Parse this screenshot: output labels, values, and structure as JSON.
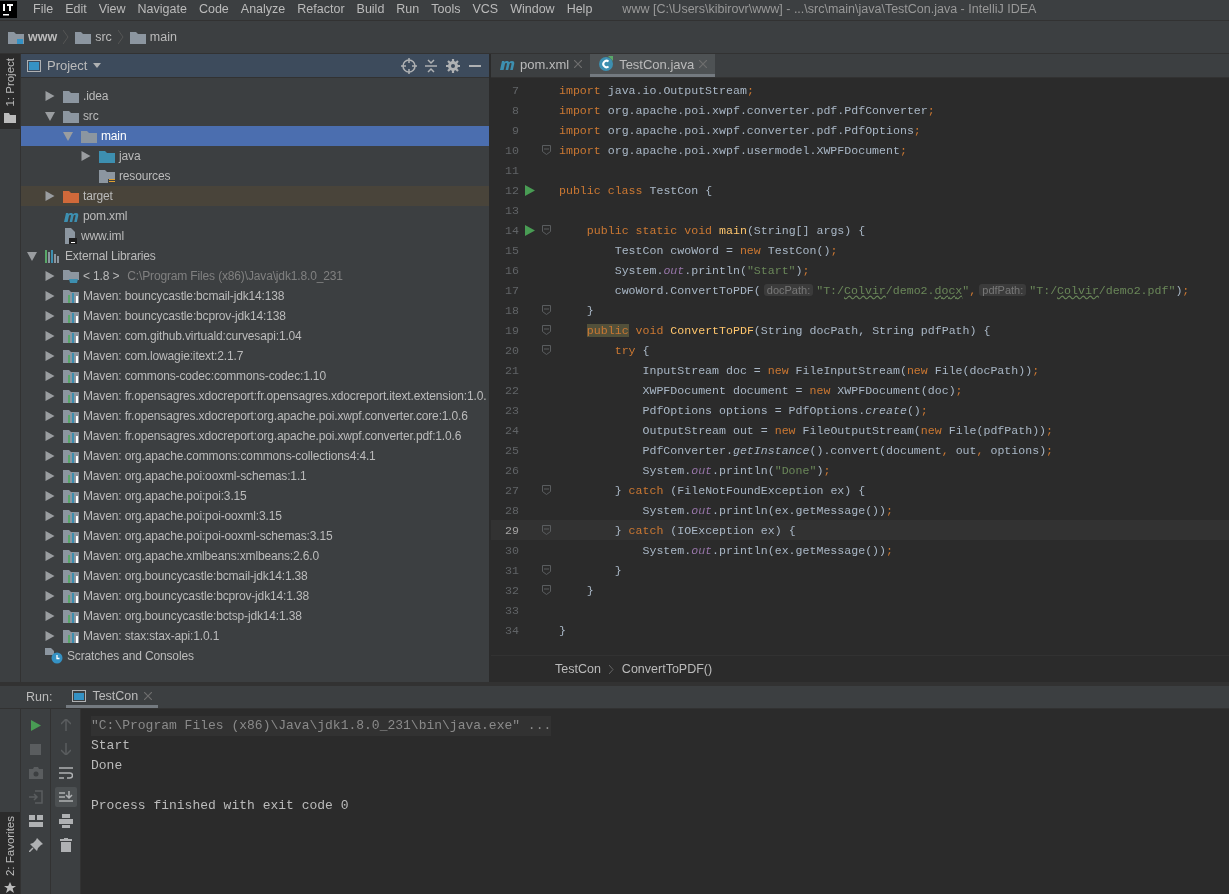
{
  "menu": [
    "File",
    "Edit",
    "View",
    "Navigate",
    "Code",
    "Analyze",
    "Refactor",
    "Build",
    "Run",
    "Tools",
    "VCS",
    "Window",
    "Help"
  ],
  "window_title": "www [C:\\Users\\kibirovr\\www] - ...\\src\\main\\java\\TestCon.java - IntelliJ IDEA",
  "navbar": [
    {
      "label": "www",
      "kind": "module"
    },
    {
      "label": "src",
      "kind": "folder"
    },
    {
      "label": "main",
      "kind": "folder"
    }
  ],
  "side_stripe": {
    "top": "1: Project",
    "bottom": "2: Favorites"
  },
  "project_panel": {
    "title": "Project",
    "tree": [
      {
        "children": [
          {
            "label": ".idea",
            "kind": "folder",
            "expanded": false,
            "selected": false
          },
          {
            "label": "src",
            "kind": "folder",
            "expanded": true,
            "selected": false,
            "children": [
              {
                "label": "main",
                "kind": "folder",
                "expanded": true,
                "selected": true,
                "children": [
                  {
                    "label": "java",
                    "kind": "source-folder",
                    "expanded": false,
                    "selected": false
                  },
                  {
                    "label": "resources",
                    "kind": "resources-folder",
                    "selected": false
                  }
                ]
              }
            ]
          },
          {
            "label": "target",
            "kind": "excluded-folder",
            "expanded": false,
            "selected": false
          },
          {
            "label": "pom.xml",
            "kind": "maven",
            "selected": false
          },
          {
            "label": "www.iml",
            "kind": "iml",
            "selected": false
          }
        ]
      },
      {
        "label": "External Libraries",
        "kind": "libraries",
        "expanded": true,
        "selected": false,
        "children": [
          {
            "label": "< 1.8 >",
            "hint": "C:\\Program Files (x86)\\Java\\jdk1.8.0_231",
            "kind": "jdk",
            "expanded": false,
            "selected": false
          },
          {
            "label": "Maven: bouncycastle:bcmail-jdk14:138",
            "kind": "library",
            "expanded": false,
            "selected": false
          },
          {
            "label": "Maven: bouncycastle:bcprov-jdk14:138",
            "kind": "library",
            "expanded": false,
            "selected": false
          },
          {
            "label": "Maven: com.github.virtuald:curvesapi:1.04",
            "kind": "library",
            "expanded": false,
            "selected": false
          },
          {
            "label": "Maven: com.lowagie:itext:2.1.7",
            "kind": "library",
            "expanded": false,
            "selected": false
          },
          {
            "label": "Maven: commons-codec:commons-codec:1.10",
            "kind": "library",
            "expanded": false,
            "selected": false
          },
          {
            "label": "Maven: fr.opensagres.xdocreport:fr.opensagres.xdocreport.itext.extension:1.0.",
            "kind": "library",
            "expanded": false,
            "selected": false
          },
          {
            "label": "Maven: fr.opensagres.xdocreport:org.apache.poi.xwpf.converter.core:1.0.6",
            "kind": "library",
            "expanded": false,
            "selected": false
          },
          {
            "label": "Maven: fr.opensagres.xdocreport:org.apache.poi.xwpf.converter.pdf:1.0.6",
            "kind": "library",
            "expanded": false,
            "selected": false
          },
          {
            "label": "Maven: org.apache.commons:commons-collections4:4.1",
            "kind": "library",
            "expanded": false,
            "selected": false
          },
          {
            "label": "Maven: org.apache.poi:ooxml-schemas:1.1",
            "kind": "library",
            "expanded": false,
            "selected": false
          },
          {
            "label": "Maven: org.apache.poi:poi:3.15",
            "kind": "library",
            "expanded": false,
            "selected": false
          },
          {
            "label": "Maven: org.apache.poi:poi-ooxml:3.15",
            "kind": "library",
            "expanded": false,
            "selected": false
          },
          {
            "label": "Maven: org.apache.poi:poi-ooxml-schemas:3.15",
            "kind": "library",
            "expanded": false,
            "selected": false
          },
          {
            "label": "Maven: org.apache.xmlbeans:xmlbeans:2.6.0",
            "kind": "library",
            "expanded": false,
            "selected": false
          },
          {
            "label": "Maven: org.bouncycastle:bcmail-jdk14:1.38",
            "kind": "library",
            "expanded": false,
            "selected": false
          },
          {
            "label": "Maven: org.bouncycastle:bcprov-jdk14:1.38",
            "kind": "library",
            "expanded": false,
            "selected": false
          },
          {
            "label": "Maven: org.bouncycastle:bctsp-jdk14:1.38",
            "kind": "library",
            "expanded": false,
            "selected": false
          },
          {
            "label": "Maven: stax:stax-api:1.0.1",
            "kind": "library",
            "expanded": false,
            "selected": false
          }
        ]
      },
      {
        "label": "Scratches and Consoles",
        "kind": "scratches",
        "selected": false
      }
    ]
  },
  "editor": {
    "tabs": [
      {
        "label": "pom.xml",
        "kind": "maven",
        "selected": false
      },
      {
        "label": "TestCon.java",
        "kind": "java",
        "selected": true
      }
    ],
    "lines": [
      {
        "number": "7",
        "run": false,
        "fold": false,
        "current": false,
        "tokens": [
          {
            "kind": "kw",
            "text": "import"
          },
          {
            "kind": "plain",
            "text": " java.io.OutputStream"
          },
          {
            "kind": "kw",
            "text": ";"
          }
        ]
      },
      {
        "number": "8",
        "run": false,
        "fold": false,
        "current": false,
        "tokens": [
          {
            "kind": "kw",
            "text": "import"
          },
          {
            "kind": "plain",
            "text": " org.apache.poi.xwpf.converter.pdf.PdfConverter"
          },
          {
            "kind": "kw",
            "text": ";"
          }
        ]
      },
      {
        "number": "9",
        "run": false,
        "fold": false,
        "current": false,
        "tokens": [
          {
            "kind": "kw",
            "text": "import"
          },
          {
            "kind": "plain",
            "text": " org.apache.poi.xwpf.converter.pdf.PdfOptions"
          },
          {
            "kind": "kw",
            "text": ";"
          }
        ]
      },
      {
        "number": "10",
        "run": false,
        "fold": true,
        "current": false,
        "tokens": [
          {
            "kind": "kw",
            "text": "import"
          },
          {
            "kind": "plain",
            "text": " org.apache.poi.xwpf.usermodel.XWPFDocument"
          },
          {
            "kind": "kw",
            "text": ";"
          }
        ]
      },
      {
        "number": "11",
        "run": false,
        "fold": false,
        "current": false
      },
      {
        "number": "12",
        "run": true,
        "fold": false,
        "current": false,
        "tokens": [
          {
            "kind": "kw",
            "text": "public class"
          },
          {
            "kind": "plain",
            "text": " TestCon {"
          }
        ]
      },
      {
        "number": "13",
        "run": false,
        "fold": false,
        "current": false
      },
      {
        "number": "14",
        "run": true,
        "fold": true,
        "current": false,
        "tokens": [
          {
            "kind": "kw",
            "text": "    public static void "
          },
          {
            "kind": "decl",
            "text": "main"
          },
          {
            "kind": "plain",
            "text": "(String[] args) {"
          }
        ]
      },
      {
        "number": "15",
        "run": false,
        "fold": false,
        "current": false,
        "tokens": [
          {
            "kind": "plain",
            "text": "        TestCon cwoWord = "
          },
          {
            "kind": "kw",
            "text": "new"
          },
          {
            "kind": "plain",
            "text": " TestCon()"
          },
          {
            "kind": "kw",
            "text": ";"
          }
        ]
      },
      {
        "number": "16",
        "run": false,
        "fold": false,
        "current": false,
        "tokens": [
          {
            "kind": "plain",
            "text": "        System."
          },
          {
            "kind": "field",
            "text": "out"
          },
          {
            "kind": "plain",
            "text": ".println("
          },
          {
            "kind": "str",
            "text": "\"Start\""
          },
          {
            "kind": "plain",
            "text": ")"
          },
          {
            "kind": "kw",
            "text": ";"
          }
        ]
      },
      {
        "number": "17",
        "run": false,
        "fold": false,
        "current": false,
        "tokens": [
          {
            "kind": "plain",
            "text": "        cwoWord.ConvertToPDF("
          },
          {
            "kind": "hint",
            "text": "docPath:"
          },
          {
            "kind": "str",
            "text": "\"T:/"
          },
          {
            "kind": "typo",
            "text": "Colvir"
          },
          {
            "kind": "str",
            "text": "/demo2."
          },
          {
            "kind": "typo",
            "text": "docx"
          },
          {
            "kind": "str",
            "text": "\""
          },
          {
            "kind": "kw",
            "text": ","
          },
          {
            "kind": "hint",
            "text": "pdfPath:"
          },
          {
            "kind": "str",
            "text": "\"T:/"
          },
          {
            "kind": "typo",
            "text": "Colvir"
          },
          {
            "kind": "str",
            "text": "/demo2.pdf\""
          },
          {
            "kind": "plain",
            "text": ")"
          },
          {
            "kind": "kw",
            "text": ";"
          }
        ]
      },
      {
        "number": "18",
        "run": false,
        "fold": true,
        "current": false,
        "tokens": [
          {
            "kind": "plain",
            "text": "    }"
          }
        ]
      },
      {
        "number": "19",
        "run": false,
        "fold": true,
        "current": false,
        "tokens": [
          {
            "kind": "marked",
            "text": "    public"
          },
          {
            "kind": "kw",
            "text": " void "
          },
          {
            "kind": "decl",
            "text": "ConvertToPDF"
          },
          {
            "kind": "plain",
            "text": "(String docPath, String pdfPath) {"
          }
        ]
      },
      {
        "number": "20",
        "run": false,
        "fold": true,
        "current": false,
        "tokens": [
          {
            "kind": "kw",
            "text": "        try"
          },
          {
            "kind": "plain",
            "text": " {"
          }
        ]
      },
      {
        "number": "21",
        "run": false,
        "fold": false,
        "current": false,
        "tokens": [
          {
            "kind": "plain",
            "text": "            InputStream doc = "
          },
          {
            "kind": "kw",
            "text": "new"
          },
          {
            "kind": "plain",
            "text": " FileInputStream("
          },
          {
            "kind": "kw",
            "text": "new"
          },
          {
            "kind": "plain",
            "text": " File(docPath))"
          },
          {
            "kind": "kw",
            "text": ";"
          }
        ]
      },
      {
        "number": "22",
        "run": false,
        "fold": false,
        "current": false,
        "tokens": [
          {
            "kind": "plain",
            "text": "            XWPFDocument document = "
          },
          {
            "kind": "kw",
            "text": "new"
          },
          {
            "kind": "plain",
            "text": " XWPFDocument(doc)"
          },
          {
            "kind": "kw",
            "text": ";"
          }
        ]
      },
      {
        "number": "23",
        "run": false,
        "fold": false,
        "current": false,
        "tokens": [
          {
            "kind": "plain",
            "text": "            PdfOptions options = PdfOptions."
          },
          {
            "kind": "italic",
            "text": "create"
          },
          {
            "kind": "plain",
            "text": "()"
          },
          {
            "kind": "kw",
            "text": ";"
          }
        ]
      },
      {
        "number": "24",
        "run": false,
        "fold": false,
        "current": false,
        "tokens": [
          {
            "kind": "plain",
            "text": "            OutputStream out = "
          },
          {
            "kind": "kw",
            "text": "new"
          },
          {
            "kind": "plain",
            "text": " FileOutputStream("
          },
          {
            "kind": "kw",
            "text": "new"
          },
          {
            "kind": "plain",
            "text": " File(pdfPath))"
          },
          {
            "kind": "kw",
            "text": ";"
          }
        ]
      },
      {
        "number": "25",
        "run": false,
        "fold": false,
        "current": false,
        "tokens": [
          {
            "kind": "plain",
            "text": "            PdfConverter."
          },
          {
            "kind": "italic",
            "text": "getInstance"
          },
          {
            "kind": "plain",
            "text": "().convert(document"
          },
          {
            "kind": "kw",
            "text": ","
          },
          {
            "kind": "plain",
            "text": " out"
          },
          {
            "kind": "kw",
            "text": ","
          },
          {
            "kind": "plain",
            "text": " options)"
          },
          {
            "kind": "kw",
            "text": ";"
          }
        ]
      },
      {
        "number": "26",
        "run": false,
        "fold": false,
        "current": false,
        "tokens": [
          {
            "kind": "plain",
            "text": "            System."
          },
          {
            "kind": "field",
            "text": "out"
          },
          {
            "kind": "plain",
            "text": ".println("
          },
          {
            "kind": "str",
            "text": "\"Done\""
          },
          {
            "kind": "plain",
            "text": ")"
          },
          {
            "kind": "kw",
            "text": ";"
          }
        ]
      },
      {
        "number": "27",
        "run": false,
        "fold": true,
        "current": false,
        "tokens": [
          {
            "kind": "plain",
            "text": "        } "
          },
          {
            "kind": "kw",
            "text": "catch"
          },
          {
            "kind": "plain",
            "text": " (FileNotFoundException ex) {"
          }
        ]
      },
      {
        "number": "28",
        "run": false,
        "fold": false,
        "current": false,
        "tokens": [
          {
            "kind": "plain",
            "text": "            System."
          },
          {
            "kind": "field",
            "text": "out"
          },
          {
            "kind": "plain",
            "text": ".println(ex.getMessage())"
          },
          {
            "kind": "kw",
            "text": ";"
          }
        ]
      },
      {
        "number": "29",
        "run": false,
        "fold": true,
        "current": true,
        "tokens": [
          {
            "kind": "plain",
            "text": "        } "
          },
          {
            "kind": "kw",
            "text": "catch"
          },
          {
            "kind": "plain",
            "text": " (IOException ex) {"
          }
        ]
      },
      {
        "number": "30",
        "run": false,
        "fold": false,
        "current": false,
        "tokens": [
          {
            "kind": "plain",
            "text": "            System."
          },
          {
            "kind": "field",
            "text": "out"
          },
          {
            "kind": "plain",
            "text": ".println(ex.getMessage())"
          },
          {
            "kind": "kw",
            "text": ";"
          }
        ]
      },
      {
        "number": "31",
        "run": false,
        "fold": true,
        "current": false,
        "tokens": [
          {
            "kind": "plain",
            "text": "        }"
          }
        ]
      },
      {
        "number": "32",
        "run": false,
        "fold": true,
        "current": false,
        "tokens": [
          {
            "kind": "plain",
            "text": "    }"
          }
        ]
      },
      {
        "number": "33",
        "run": false,
        "fold": false,
        "current": false
      },
      {
        "number": "34",
        "run": false,
        "fold": false,
        "current": false,
        "tokens": [
          {
            "kind": "plain",
            "text": "}"
          }
        ]
      }
    ],
    "breadcrumbs": [
      "TestCon",
      "ConvertToPDF()"
    ]
  },
  "run_panel": {
    "label": "Run:",
    "tabs": [
      {
        "label": "TestCon",
        "selected": true
      }
    ],
    "console": [
      {
        "kind": "command",
        "text": "\"C:\\Program Files (x86)\\Java\\jdk1.8.0_231\\bin\\java.exe\" ..."
      },
      {
        "kind": "output",
        "text": "Start"
      },
      {
        "kind": "output",
        "text": "Done"
      },
      {
        "kind": "exit",
        "text": "Process finished with exit code 0"
      }
    ]
  }
}
